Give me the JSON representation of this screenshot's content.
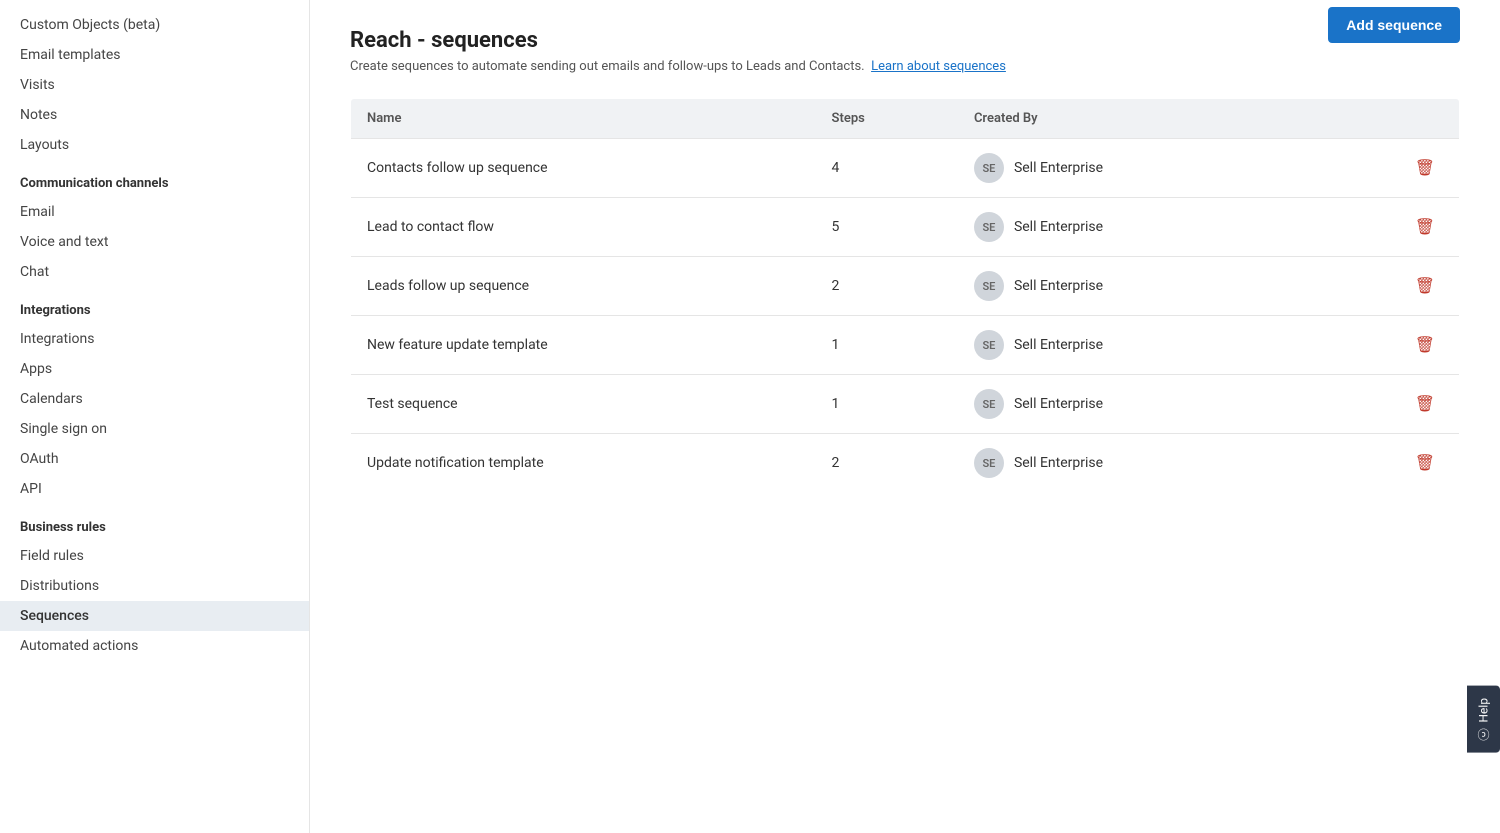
{
  "sidebar": {
    "items_top": [
      {
        "id": "custom-objects",
        "label": "Custom Objects (beta)",
        "active": false
      },
      {
        "id": "email-templates",
        "label": "Email templates",
        "active": false
      },
      {
        "id": "visits",
        "label": "Visits",
        "active": false
      },
      {
        "id": "notes",
        "label": "Notes",
        "active": false
      },
      {
        "id": "layouts",
        "label": "Layouts",
        "active": false
      }
    ],
    "sections": [
      {
        "id": "communication-channels",
        "header": "Communication channels",
        "items": [
          {
            "id": "email",
            "label": "Email",
            "active": false
          },
          {
            "id": "voice-and-text",
            "label": "Voice and text",
            "active": false
          },
          {
            "id": "chat",
            "label": "Chat",
            "active": false
          }
        ]
      },
      {
        "id": "integrations",
        "header": "Integrations",
        "items": [
          {
            "id": "integrations",
            "label": "Integrations",
            "active": false
          },
          {
            "id": "apps",
            "label": "Apps",
            "active": false
          },
          {
            "id": "calendars",
            "label": "Calendars",
            "active": false
          },
          {
            "id": "single-sign-on",
            "label": "Single sign on",
            "active": false
          },
          {
            "id": "oauth",
            "label": "OAuth",
            "active": false
          },
          {
            "id": "api",
            "label": "API",
            "active": false
          }
        ]
      },
      {
        "id": "business-rules",
        "header": "Business rules",
        "items": [
          {
            "id": "field-rules",
            "label": "Field rules",
            "active": false
          },
          {
            "id": "distributions",
            "label": "Distributions",
            "active": false
          },
          {
            "id": "sequences",
            "label": "Sequences",
            "active": true
          },
          {
            "id": "automated-actions",
            "label": "Automated actions",
            "active": false
          }
        ]
      }
    ]
  },
  "main": {
    "title": "Reach - sequences",
    "description": "Create sequences to automate sending out emails and follow-ups to Leads and Contacts.",
    "learn_link_text": "Learn about sequences",
    "add_button_label": "Add sequence",
    "table": {
      "columns": [
        {
          "id": "name",
          "label": "Name"
        },
        {
          "id": "steps",
          "label": "Steps"
        },
        {
          "id": "created_by",
          "label": "Created By"
        }
      ],
      "rows": [
        {
          "id": 1,
          "name": "Contacts follow up sequence",
          "steps": "4",
          "avatar_initials": "SE",
          "created_by": "Sell Enterprise"
        },
        {
          "id": 2,
          "name": "Lead to contact flow",
          "steps": "5",
          "avatar_initials": "SE",
          "created_by": "Sell Enterprise"
        },
        {
          "id": 3,
          "name": "Leads follow up sequence",
          "steps": "2",
          "avatar_initials": "SE",
          "created_by": "Sell Enterprise"
        },
        {
          "id": 4,
          "name": "New feature update template",
          "steps": "1",
          "avatar_initials": "SE",
          "created_by": "Sell Enterprise"
        },
        {
          "id": 5,
          "name": "Test sequence",
          "steps": "1",
          "avatar_initials": "SE",
          "created_by": "Sell Enterprise"
        },
        {
          "id": 6,
          "name": "Update notification template",
          "steps": "2",
          "avatar_initials": "SE",
          "created_by": "Sell Enterprise"
        }
      ]
    }
  },
  "help": {
    "label": "Help"
  }
}
